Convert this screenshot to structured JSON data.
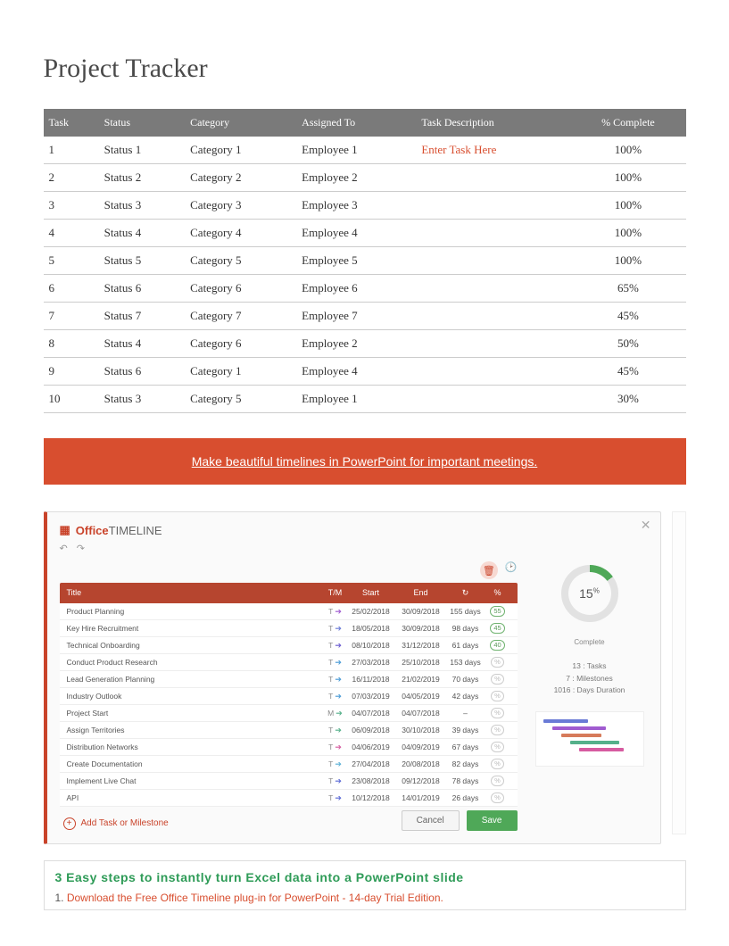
{
  "page_title": "Project Tracker",
  "table": {
    "headers": {
      "task": "Task",
      "status": "Status",
      "category": "Category",
      "assigned": "Assigned To",
      "desc": "Task Description",
      "pct": "% Complete"
    },
    "rows": [
      {
        "task": "1",
        "status": "Status 1",
        "category": "Category 1",
        "assigned": "Employee 1",
        "desc": "Enter Task Here",
        "desc_placeholder": true,
        "pct": "100%"
      },
      {
        "task": "2",
        "status": "Status 2",
        "category": "Category 2",
        "assigned": "Employee 2",
        "desc": "",
        "pct": "100%"
      },
      {
        "task": "3",
        "status": "Status 3",
        "category": "Category 3",
        "assigned": "Employee 3",
        "desc": "",
        "pct": "100%"
      },
      {
        "task": "4",
        "status": "Status 4",
        "category": "Category 4",
        "assigned": "Employee 4",
        "desc": "",
        "pct": "100%"
      },
      {
        "task": "5",
        "status": "Status 5",
        "category": "Category 5",
        "assigned": "Employee 5",
        "desc": "",
        "pct": "100%"
      },
      {
        "task": "6",
        "status": "Status 6",
        "category": "Category 6",
        "assigned": "Employee 6",
        "desc": "",
        "pct": "65%"
      },
      {
        "task": "7",
        "status": "Status 7",
        "category": "Category 7",
        "assigned": "Employee 7",
        "desc": "",
        "pct": "45%"
      },
      {
        "task": "8",
        "status": "Status 4",
        "category": "Category 6",
        "assigned": "Employee 2",
        "desc": "",
        "pct": "50%"
      },
      {
        "task": "9",
        "status": "Status 6",
        "category": "Category 1",
        "assigned": "Employee 4",
        "desc": "",
        "pct": "45%"
      },
      {
        "task": "10",
        "status": "Status 3",
        "category": "Category 5",
        "assigned": "Employee 1",
        "desc": "",
        "pct": "30%"
      }
    ]
  },
  "cta": "Make beautiful timelines in PowerPoint for important meetings.",
  "ot": {
    "brand_prefix": "Office",
    "brand_suffix": "TIMELINE",
    "headers": {
      "title": "Title",
      "tm": "T/M",
      "start": "Start",
      "end": "End",
      "dur": "↻",
      "pct": "%"
    },
    "rows": [
      {
        "title": "Product Planning",
        "tm": "T",
        "color": "#a05bd0",
        "start": "25/02/2018",
        "end": "30/09/2018",
        "dur": "155 days",
        "pct": "55"
      },
      {
        "title": "Key Hire Recruitment",
        "tm": "T",
        "color": "#6a7bd6",
        "start": "18/05/2018",
        "end": "30/09/2018",
        "dur": "98 days",
        "pct": "45"
      },
      {
        "title": "Technical Onboarding",
        "tm": "T",
        "color": "#6a5bd0",
        "start": "08/10/2018",
        "end": "31/12/2018",
        "dur": "61 days",
        "pct": "40"
      },
      {
        "title": "Conduct Product Research",
        "tm": "T",
        "color": "#4a9bd6",
        "start": "27/03/2018",
        "end": "25/10/2018",
        "dur": "153 days",
        "pct": "%"
      },
      {
        "title": "Lead Generation Planning",
        "tm": "T",
        "color": "#4a9bd6",
        "start": "16/11/2018",
        "end": "21/02/2019",
        "dur": "70 days",
        "pct": "%"
      },
      {
        "title": "Industry Outlook",
        "tm": "T",
        "color": "#4a9bd6",
        "start": "07/03/2019",
        "end": "04/05/2019",
        "dur": "42 days",
        "pct": "%"
      },
      {
        "title": "Project Start",
        "tm": "M",
        "color": "#55b08a",
        "start": "04/07/2018",
        "end": "04/07/2018",
        "dur": "–",
        "pct": "%"
      },
      {
        "title": "Assign Territories",
        "tm": "T",
        "color": "#55b08a",
        "start": "06/09/2018",
        "end": "30/10/2018",
        "dur": "39 days",
        "pct": "%"
      },
      {
        "title": "Distribution Networks",
        "tm": "T",
        "color": "#d65ba0",
        "start": "04/06/2019",
        "end": "04/09/2019",
        "dur": "67 days",
        "pct": "%"
      },
      {
        "title": "Create Documentation",
        "tm": "T",
        "color": "#5bb0d6",
        "start": "27/04/2018",
        "end": "20/08/2018",
        "dur": "82 days",
        "pct": "%"
      },
      {
        "title": "Implement Live Chat",
        "tm": "T",
        "color": "#5b6ad6",
        "start": "23/08/2018",
        "end": "09/12/2018",
        "dur": "78 days",
        "pct": "%"
      },
      {
        "title": "API",
        "tm": "T",
        "color": "#5b6ad6",
        "start": "10/12/2018",
        "end": "14/01/2019",
        "dur": "26 days",
        "pct": "%"
      }
    ],
    "add_label": "Add Task or Milestone",
    "cancel": "Cancel",
    "save": "Save",
    "donut": {
      "value": "15",
      "unit": "%",
      "label": "Complete"
    },
    "stats": {
      "tasks": "13 : Tasks",
      "milestones": "7 : Milestones",
      "duration": "1016 : Days Duration"
    }
  },
  "steps": {
    "title": "3 Easy steps to instantly turn Excel data into a PowerPoint slide",
    "step1_num": "1. ",
    "step1_text": "Download the Free Office Timeline plug-in for PowerPoint - 14-day Trial Edition."
  }
}
